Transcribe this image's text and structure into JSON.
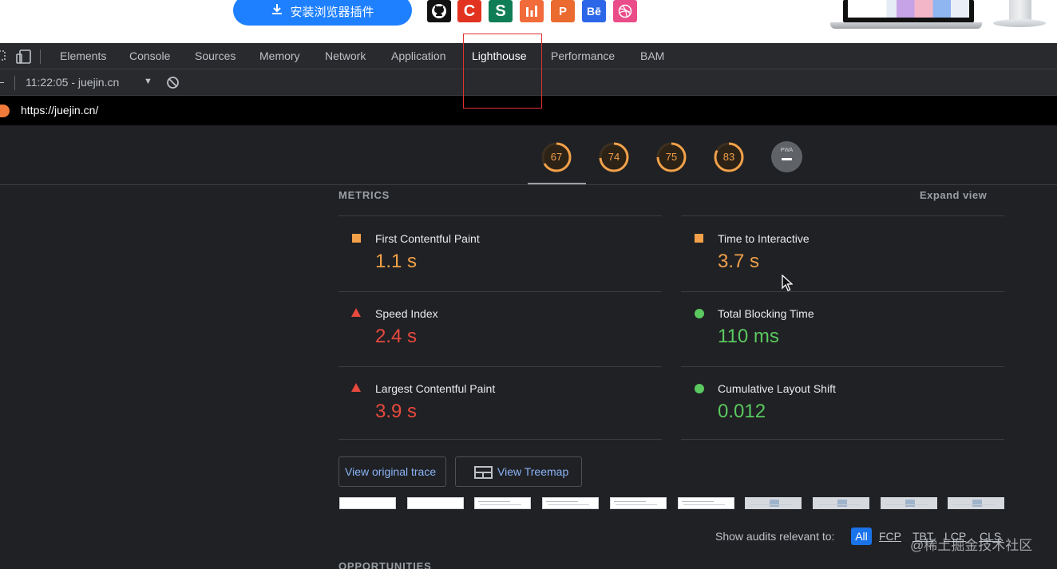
{
  "web": {
    "install_button_label": "安装浏览器插件",
    "install_icon": "download-icon",
    "site_icons": [
      {
        "name": "github-icon",
        "glyph": "",
        "color": "#111111"
      },
      {
        "name": "csdn-icon",
        "glyph": "C",
        "color": "#e1331f"
      },
      {
        "name": "segmentfault-icon",
        "glyph": "S",
        "color": "#0f7d55"
      },
      {
        "name": "chart-icon",
        "glyph": "",
        "color": "#f26b3a"
      },
      {
        "name": "producthunt-icon",
        "glyph": "P",
        "color": "#ea6a2f"
      },
      {
        "name": "behance-icon",
        "glyph": "Bē",
        "color": "#2b67e8"
      },
      {
        "name": "dribbble-icon",
        "glyph": "",
        "color": "#ea4c89"
      }
    ]
  },
  "devtools": {
    "tabs": [
      "Elements",
      "Console",
      "Sources",
      "Memory",
      "Network",
      "Application",
      "Lighthouse",
      "Performance",
      "BAM"
    ],
    "active_tab": "Lighthouse",
    "report_select": "11:22:05 - juejin.cn",
    "url": "https://juejin.cn/"
  },
  "scores": {
    "values": [
      "67",
      "74",
      "75",
      "83"
    ],
    "color": "#f2a14a",
    "pwa_label": "PWA"
  },
  "metrics": {
    "title": "METRICS",
    "expand_label": "Expand view",
    "items": [
      {
        "label": "First Contentful Paint",
        "value": "1.1 s",
        "status": "average"
      },
      {
        "label": "Time to Interactive",
        "value": "3.7 s",
        "status": "average"
      },
      {
        "label": "Speed Index",
        "value": "2.4 s",
        "status": "fail"
      },
      {
        "label": "Total Blocking Time",
        "value": "110 ms",
        "status": "pass"
      },
      {
        "label": "Largest Contentful Paint",
        "value": "3.9 s",
        "status": "fail"
      },
      {
        "label": "Cumulative Layout Shift",
        "value": "0.012",
        "status": "pass"
      }
    ]
  },
  "buttons": {
    "view_trace": "View original trace",
    "view_treemap": "View Treemap"
  },
  "audits_filter": {
    "label": "Show audits relevant to:",
    "options": [
      "All",
      "FCP",
      "TBT",
      "LCP",
      "CLS"
    ],
    "selected": "All"
  },
  "watermark": "@稀土掘金技术社区",
  "opportunities_title": "OPPORTUNITIES",
  "colors": {
    "accent_blue": "#1e80ff",
    "highlight_box": "#e03131",
    "pass": "#5ac95f",
    "average": "#f2a14a",
    "fail": "#e8493e"
  }
}
